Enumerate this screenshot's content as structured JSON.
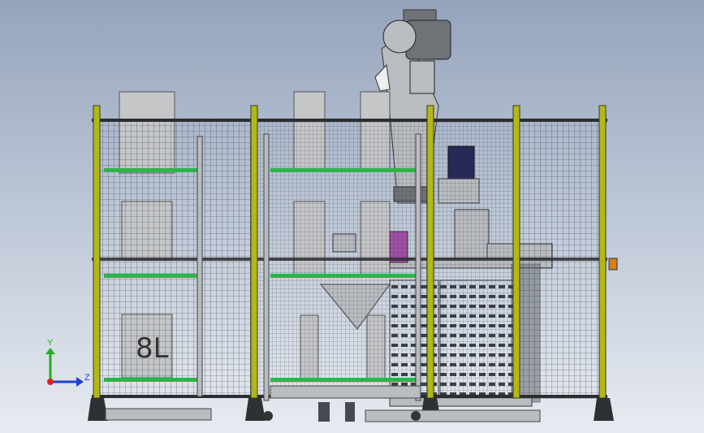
{
  "viewport": {
    "background_top": "#95a4bd",
    "background_bottom": "#e7ebf1"
  },
  "colors": {
    "frame_post": "#b2b81a",
    "frame_post_dark": "#3a3d10",
    "mesh_line": "#2a2e35",
    "shelf_green": "#2fb34a",
    "metal_gray": "#b9bcc0",
    "metal_dark": "#6f7378",
    "panel_gray": "#c4c6c8",
    "motor_blue": "#28285a",
    "magenta_part": "#a24fa8",
    "orange_part": "#d47f1c",
    "axis_x": "#e02020",
    "axis_y": "#20b020",
    "axis_z": "#2040d0"
  },
  "labels": {
    "bin_label": "8L"
  },
  "triad": {
    "y_label": "Y",
    "z_label": "Z"
  }
}
